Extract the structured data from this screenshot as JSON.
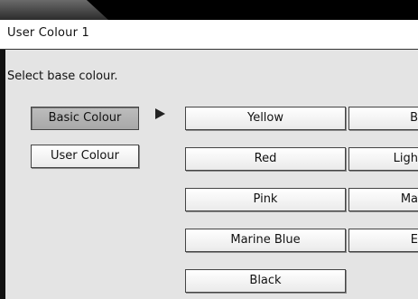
{
  "window": {
    "title": "User Colour  1"
  },
  "main": {
    "prompt": "Select base colour.",
    "category_buttons": [
      {
        "label": "Basic Colour",
        "selected": true
      },
      {
        "label": "User Colour",
        "selected": false
      }
    ],
    "colour_column_1": [
      "Yellow",
      "Red",
      "Pink",
      "Marine Blue",
      "Black"
    ],
    "colour_column_2_visible": [
      "B",
      "Ligh",
      "Ma",
      "E"
    ]
  },
  "icons": {
    "selection_arrow": "right-triangle-icon"
  }
}
